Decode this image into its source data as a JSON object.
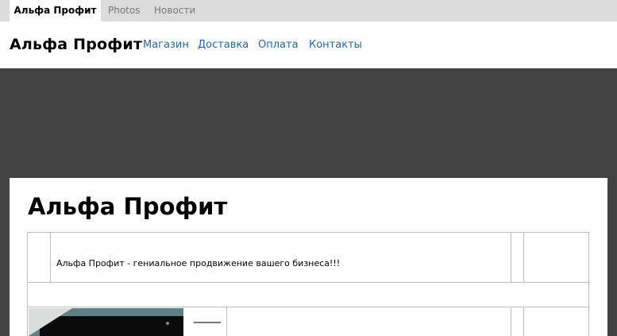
{
  "topbar": {
    "tabs": [
      {
        "label": "Альфа Профит",
        "active": true
      },
      {
        "label": "Photos",
        "active": false
      },
      {
        "label": "Новости",
        "active": false
      }
    ]
  },
  "header": {
    "brand": "Альфа Профит",
    "nav": [
      "Магазин",
      "Доставка",
      "Оплата",
      "Контакты"
    ]
  },
  "content": {
    "title": "Альфа Профит",
    "slogan": "Альфа Профит - гениальное продвижение вашего бизнеса!!!"
  },
  "colors": {
    "background": "#424242",
    "tabbar": "#dcdcdc",
    "link": "#1a66c2"
  }
}
